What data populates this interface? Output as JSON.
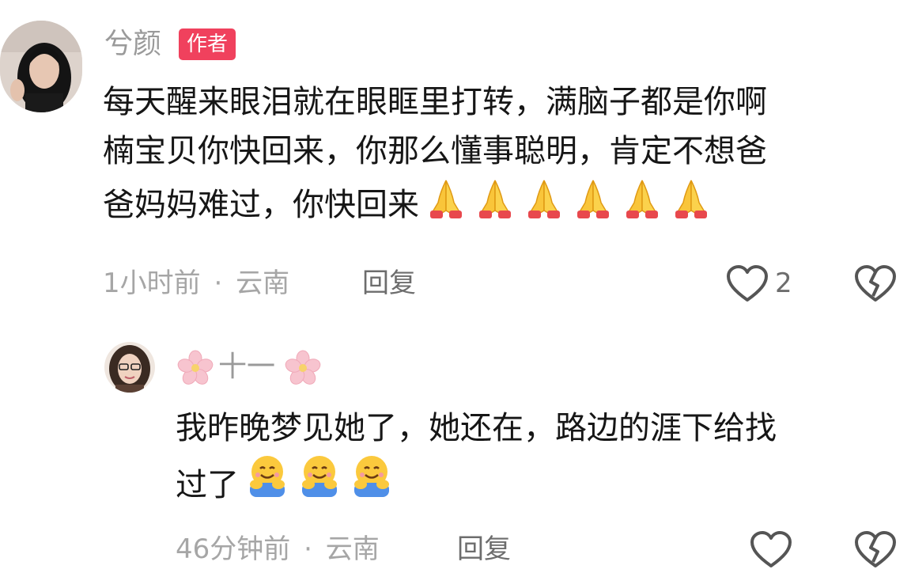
{
  "comment": {
    "author": "兮颜",
    "badge": "作者",
    "text_lines": [
      "每天醒来眼泪就在眼眶里打转，满脑子都是你啊",
      "楠宝贝你快回来，你那么懂事聪明，肯定不想爸",
      "爸妈妈难过，你快回来"
    ],
    "emoji_icon": "folded-hands-icon",
    "emoji_count": 6,
    "time": "1小时前",
    "separator": "·",
    "location": "云南",
    "reply_label": "回复",
    "like_count": "2"
  },
  "reply": {
    "author": "十一",
    "name_decoration_icon": "cherry-blossom-icon",
    "text_lines": [
      "我昨晚梦见她了，她还在，路边的涯下给找",
      "过了"
    ],
    "emoji_icon": "hugging-face-icon",
    "emoji_count": 3,
    "time": "46分钟前",
    "separator": "·",
    "location": "云南",
    "reply_label": "回复"
  },
  "colors": {
    "badge": "#f0415d",
    "name": "#9a9a9a",
    "meta": "#a6a6a6",
    "text": "#161616"
  }
}
